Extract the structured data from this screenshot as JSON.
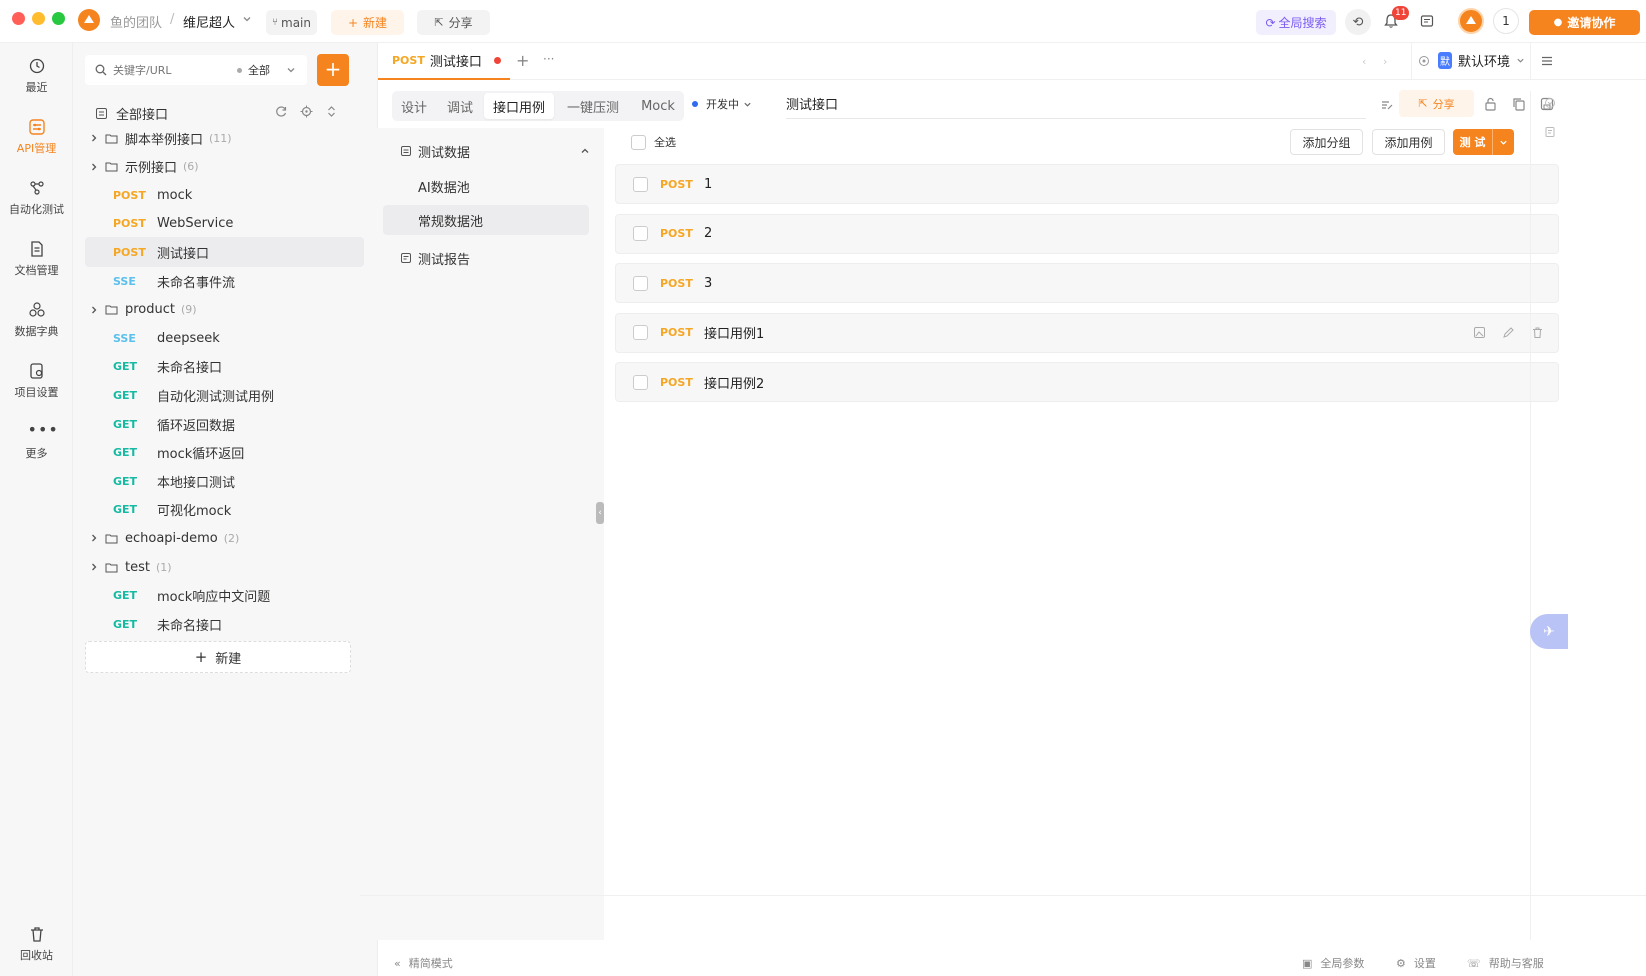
{
  "titlebar": {
    "team": "鱼的团队",
    "separator": "/",
    "project": "维尼超人",
    "branch": "main",
    "new_label": "新建",
    "share_label": "分享",
    "global_search": "全局搜索",
    "notif_count": "11",
    "user_count": "1",
    "invite_label": "邀请协作"
  },
  "rail": {
    "items": [
      {
        "label": "最近",
        "icon": "history-icon"
      },
      {
        "label": "API管理",
        "icon": "api-icon",
        "active": true
      },
      {
        "label": "自动化测试",
        "icon": "flow-icon"
      },
      {
        "label": "文档管理",
        "icon": "doc-icon"
      },
      {
        "label": "数据字典",
        "icon": "dict-icon"
      },
      {
        "label": "项目设置",
        "icon": "settings-icon"
      },
      {
        "label": "更多",
        "icon": "more-icon"
      }
    ],
    "trash_label": "回收站"
  },
  "tree": {
    "search_placeholder": "关键字/URL",
    "filter": "全部",
    "root_label": "全部接口",
    "items": [
      {
        "type": "folder",
        "label": "脚本举例接口",
        "count": "(11)"
      },
      {
        "type": "folder",
        "label": "示例接口",
        "count": "(6)"
      },
      {
        "type": "api",
        "method": "POST",
        "label": "mock"
      },
      {
        "type": "api",
        "method": "POST",
        "label": "WebService"
      },
      {
        "type": "api",
        "method": "POST",
        "label": "测试接口",
        "selected": true
      },
      {
        "type": "api",
        "method": "SSE",
        "label": "未命名事件流"
      },
      {
        "type": "folder",
        "label": "product",
        "count": "(9)"
      },
      {
        "type": "api",
        "method": "SSE",
        "label": "deepseek"
      },
      {
        "type": "api",
        "method": "GET",
        "label": "未命名接口"
      },
      {
        "type": "api",
        "method": "GET",
        "label": "自动化测试测试用例"
      },
      {
        "type": "api",
        "method": "GET",
        "label": "循环返回数据"
      },
      {
        "type": "api",
        "method": "GET",
        "label": "mock循环返回"
      },
      {
        "type": "api",
        "method": "GET",
        "label": "本地接口测试"
      },
      {
        "type": "api",
        "method": "GET",
        "label": "可视化mock"
      },
      {
        "type": "folder",
        "label": "echoapi-demo",
        "count": "(2)"
      },
      {
        "type": "folder",
        "label": "test",
        "count": "(1)"
      },
      {
        "type": "api",
        "method": "GET",
        "label": "mock响应中文问题"
      },
      {
        "type": "api",
        "method": "GET",
        "label": "未命名接口"
      }
    ],
    "new_label": "新建"
  },
  "tab": {
    "method": "POST",
    "name": "测试接口",
    "add": "+",
    "more": "···"
  },
  "env": "默认环境",
  "env_badge": "默",
  "subtabs": [
    "设计",
    "调试",
    "接口用例",
    "一键压测",
    "Mock"
  ],
  "active_subtab": "接口用例",
  "status": "开发中",
  "api_name": "测试接口",
  "share_label": "分享",
  "testdata": {
    "group_label": "测试数据",
    "items": [
      "AI数据池",
      "常规数据池"
    ],
    "report_label": "测试报告"
  },
  "cases": {
    "select_all": "全选",
    "add_group": "添加分组",
    "add_case": "添加用例",
    "test_label": "测 试",
    "list": [
      {
        "method": "POST",
        "name": "1"
      },
      {
        "method": "POST",
        "name": "2"
      },
      {
        "method": "POST",
        "name": "3"
      },
      {
        "method": "POST",
        "name": "接口用例1",
        "hover": true
      },
      {
        "method": "POST",
        "name": "接口用例2"
      }
    ]
  },
  "footer": {
    "simple_mode": "精简模式",
    "global_params": "全局参数",
    "settings": "设置",
    "help": "帮助与客服"
  },
  "colors": {
    "accent": "#f5841f",
    "post": "#f5a623",
    "get": "#16b9a2",
    "sse": "#5bc0eb"
  }
}
